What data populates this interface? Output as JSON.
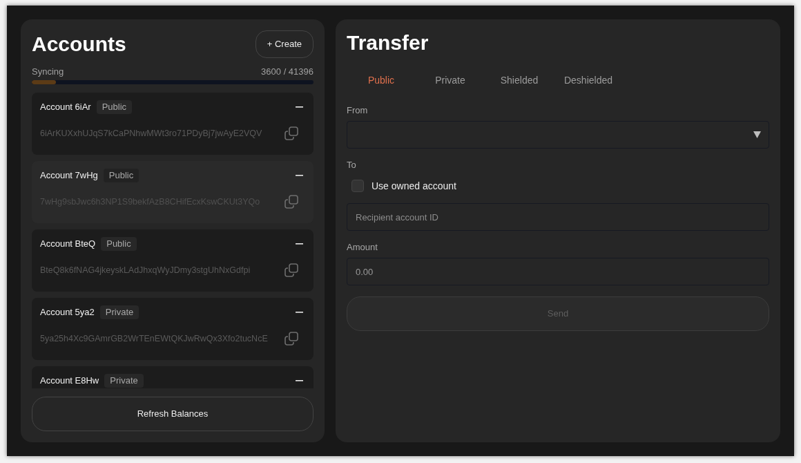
{
  "accounts_panel": {
    "title": "Accounts",
    "create_button": "+ Create",
    "sync": {
      "label": "Syncing",
      "progress": "3600 / 41396",
      "level": 0.087
    },
    "accounts": [
      {
        "name": "Account 6iAr",
        "type": "Public",
        "address": "6iArKUXxhUJqS7kCaPNhwMWt3ro71PDyBj7jwAyE2VQV",
        "selected": false
      },
      {
        "name": "Account 7wHg",
        "type": "Public",
        "address": "7wHg9sbJwc6h3NP1S9bekfAzB8CHifEcxKswCKUt3YQo",
        "selected": true
      },
      {
        "name": "Account BteQ",
        "type": "Public",
        "address": "BteQ8k6fNAG4jkeyskLAdJhxqWyJDmy3stgUhNxGdfpi",
        "selected": false
      },
      {
        "name": "Account 5ya2",
        "type": "Private",
        "address": "5ya25h4Xc9GAmrGB2WrTEnEWtQKJwRwQx3Xfo2tucNcE",
        "selected": false
      },
      {
        "name": "Account E8Hw",
        "type": "Private",
        "selected": false
      }
    ],
    "refresh_button": "Refresh Balances"
  },
  "transfer_panel": {
    "title": "Transfer",
    "tabs": [
      {
        "label": "Public",
        "selected": true
      },
      {
        "label": "Private",
        "selected": false
      },
      {
        "label": "Shielded",
        "selected": false
      },
      {
        "label": "Deshielded",
        "selected": false
      }
    ],
    "from": {
      "label": "From"
    },
    "to": {
      "label": "To",
      "use_owned_account": {
        "label": "Use owned account",
        "checked": false
      },
      "recipient": {
        "placeholder": "Recipient account ID"
      }
    },
    "amount": {
      "label": "Amount",
      "placeholder": "0.00"
    },
    "send_button": {
      "label": "Send",
      "disabled": true
    }
  }
}
